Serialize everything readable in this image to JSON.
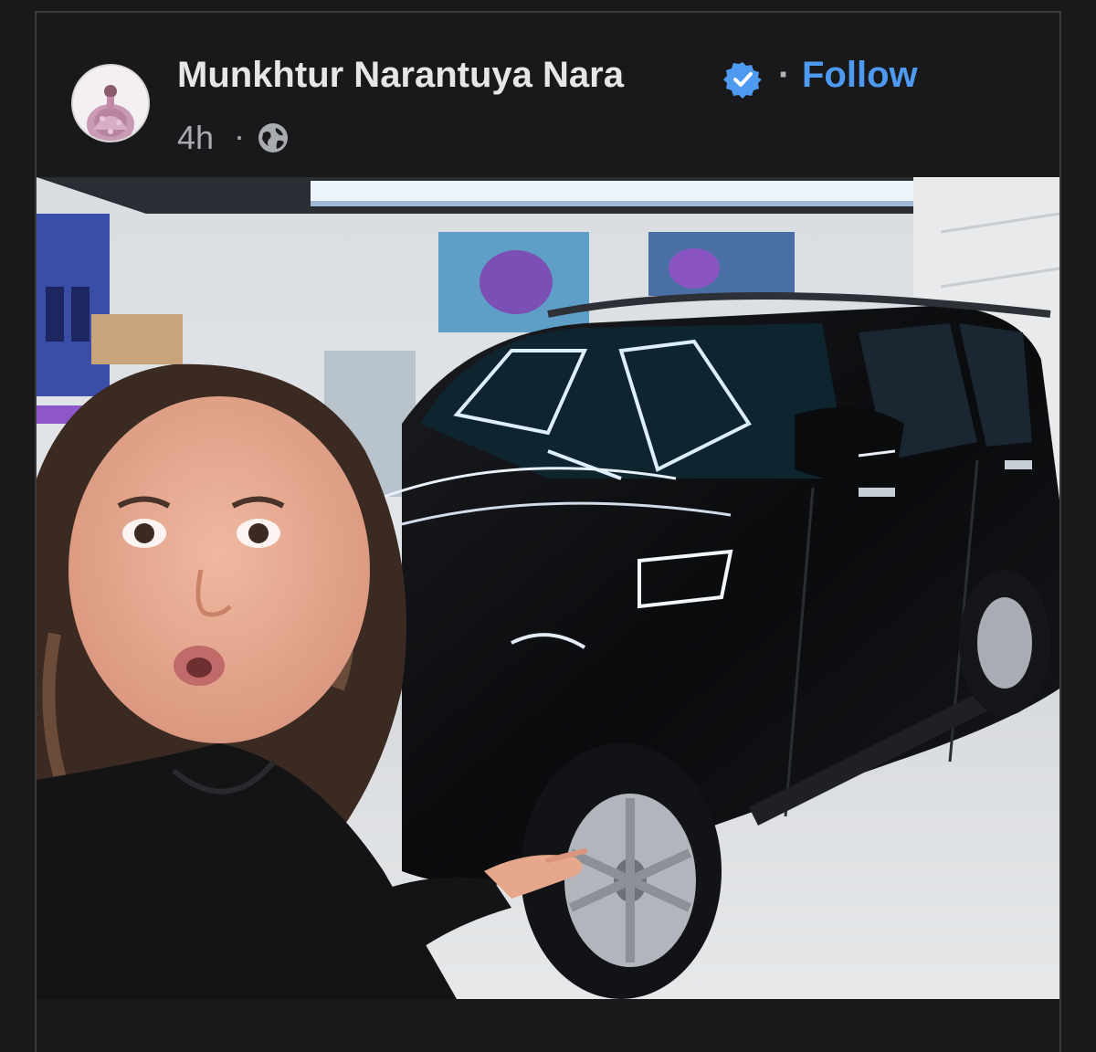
{
  "post": {
    "author": "Munkhtur Narantuya Nara",
    "separator": "·",
    "follow_label": "Follow",
    "time": "4h",
    "time_separator": "·",
    "audience_icon": "globe-icon",
    "verified_icon": "verified-badge-icon"
  },
  "colors": {
    "background": "#19191b",
    "name_text": "#e6e6e8",
    "follow_link": "#4e9af1",
    "verified_badge": "#4e9af1",
    "meta_text": "#a8abb0"
  }
}
